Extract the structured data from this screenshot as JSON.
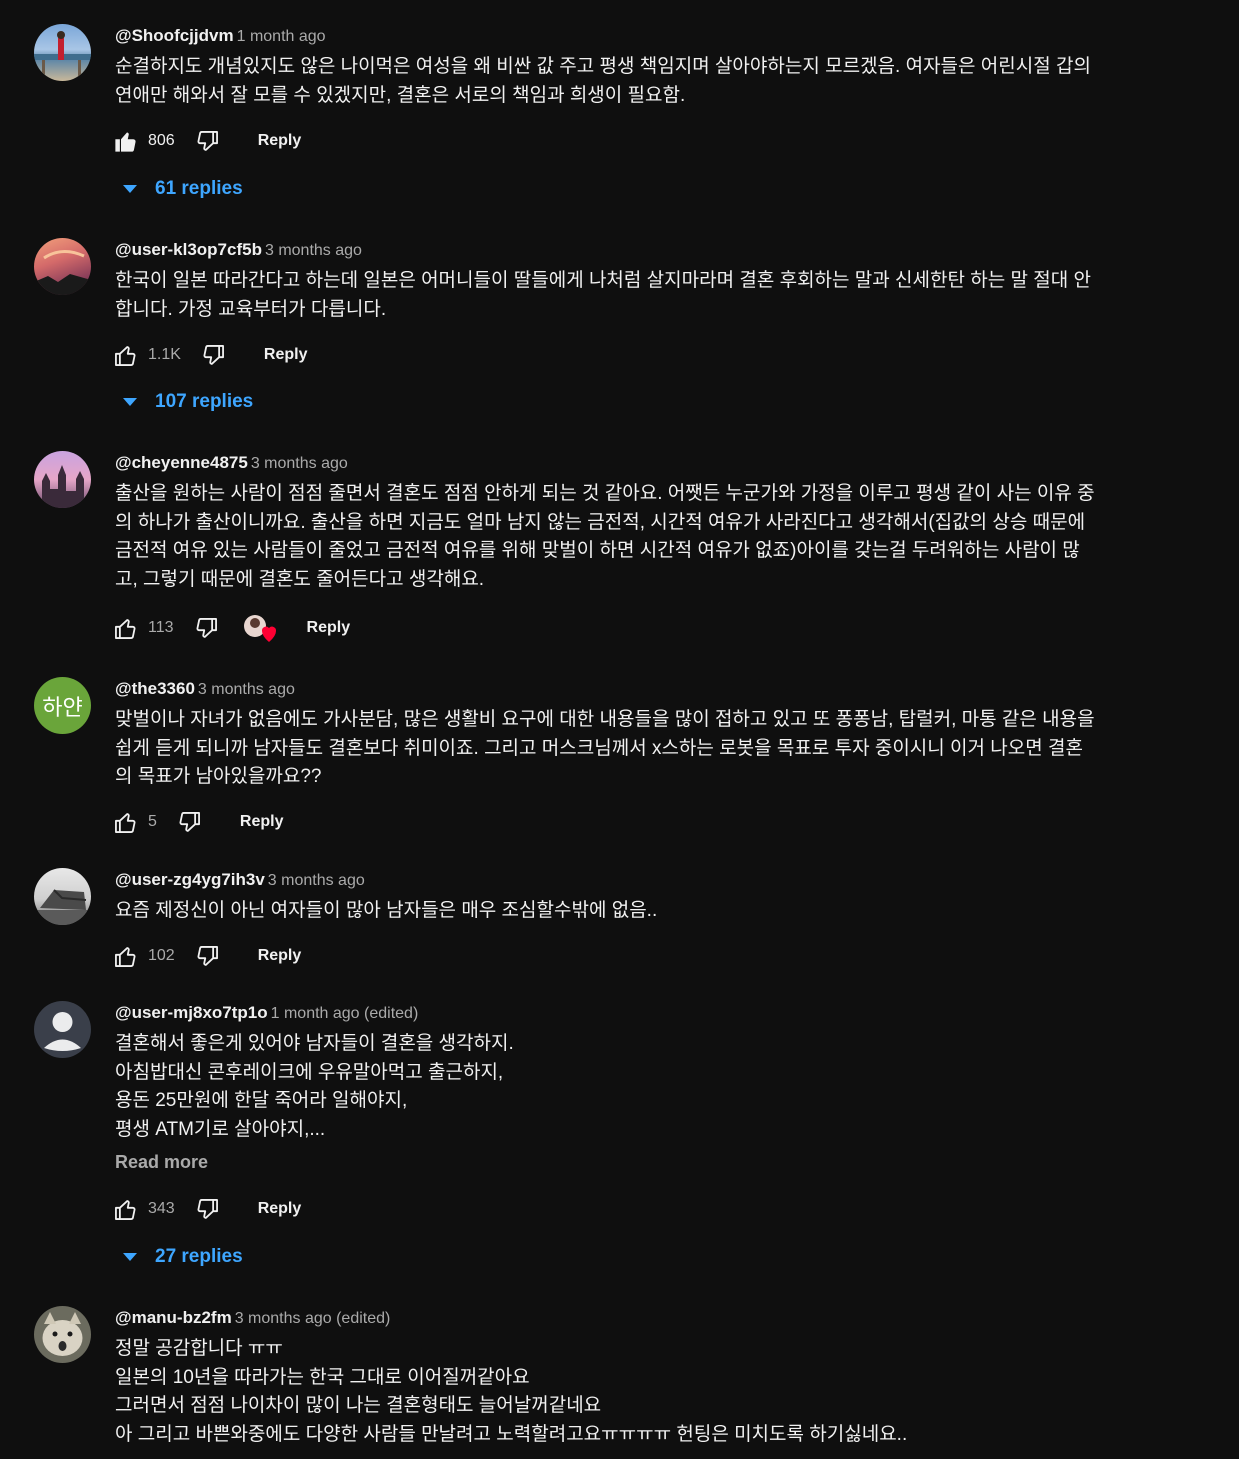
{
  "comments": [
    {
      "author": "@Shoofcjjdvm",
      "time": "1 month ago",
      "text": "순결하지도 개념있지도 않은 나이먹은 여성을 왜 비싼 값 주고 평생 책임지며 살아야하는지 모르겠음. 여자들은 어린시절 갑의\n연애만 해와서 잘 모를 수 있겠지만, 결혼은 서로의 책임과 희생이 필요함.",
      "likes": "806",
      "reply_label": "Reply",
      "replies": "61 replies"
    },
    {
      "author": "@user-kl3op7cf5b",
      "time": "3 months ago",
      "text": "한국이 일본 따라간다고 하는데 일본은 어머니들이 딸들에게 나처럼 살지마라며 결혼 후회하는 말과 신세한탄 하는 말 절대 안\n합니다.  가정 교육부터가 다릅니다.",
      "likes": "1.1K",
      "reply_label": "Reply",
      "replies": "107 replies"
    },
    {
      "author": "@cheyenne4875",
      "time": "3 months ago",
      "text": "출산을 원하는 사람이 점점 줄면서 결혼도 점점 안하게 되는 것 같아요. 어쨋든 누군가와 가정을 이루고 평생 같이 사는 이유 중\n의 하나가 출산이니까요. 출산을 하면 지금도 얼마 남지 않는 금전적, 시간적 여유가 사라진다고 생각해서(집값의 상승 때문에\n금전적 여유 있는 사람들이 줄었고 금전적 여유를 위해 맞벌이 하면 시간적 여유가 없죠)아이를 갖는걸 두려워하는 사람이 많\n고, 그렇기 때문에 결혼도 줄어든다고 생각해요.",
      "likes": "113",
      "reply_label": "Reply"
    },
    {
      "author": "@the3360",
      "time": "3 months ago",
      "avatar_text": "하얀",
      "text": "맞벌이나 자녀가 없음에도 가사분담, 많은 생활비 요구에 대한 내용들을 많이 접하고 있고 또 퐁퐁남, 탑럴커, 마통 같은 내용을\n쉽게 듣게 되니까 남자들도 결혼보다 취미이죠. 그리고 머스크님께서 x스하는 로봇을 목표로 투자 중이시니 이거 나오면 결혼\n의 목표가 남아있을까요??",
      "likes": "5",
      "reply_label": "Reply"
    },
    {
      "author": "@user-zg4yg7ih3v",
      "time": "3 months ago",
      "text": "요즘 제정신이 아닌 여자들이 많아 남자들은 매우 조심할수밖에 없음..",
      "likes": "102",
      "reply_label": "Reply"
    },
    {
      "author": "@user-mj8xo7tp1o",
      "time": "1 month ago (edited)",
      "text": "결혼해서 좋은게 있어야 남자들이 결혼을 생각하지.\n아침밥대신 콘후레이크에 우유말아먹고 출근하지,\n용돈 25만원에 한달 죽어라 일해야지,\n평생 ATM기로 살아야지,...",
      "read_more": "Read more",
      "likes": "343",
      "reply_label": "Reply",
      "replies": "27 replies"
    },
    {
      "author": "@manu-bz2fm",
      "time": "3 months ago (edited)",
      "text": "정말 공감합니다 ㅠㅠ\n일본의 10년을 따라가는 한국 그대로 이어질꺼같아요\n그러면서 점점 나이차이 많이 나는 결혼형태도 늘어날꺼같네요\n아 그리고 바쁜와중에도 다양한 사람들 만날려고 노력할려고요ㅠㅠㅠㅠ 헌팅은 미치도록 하기싫네요.."
    }
  ]
}
